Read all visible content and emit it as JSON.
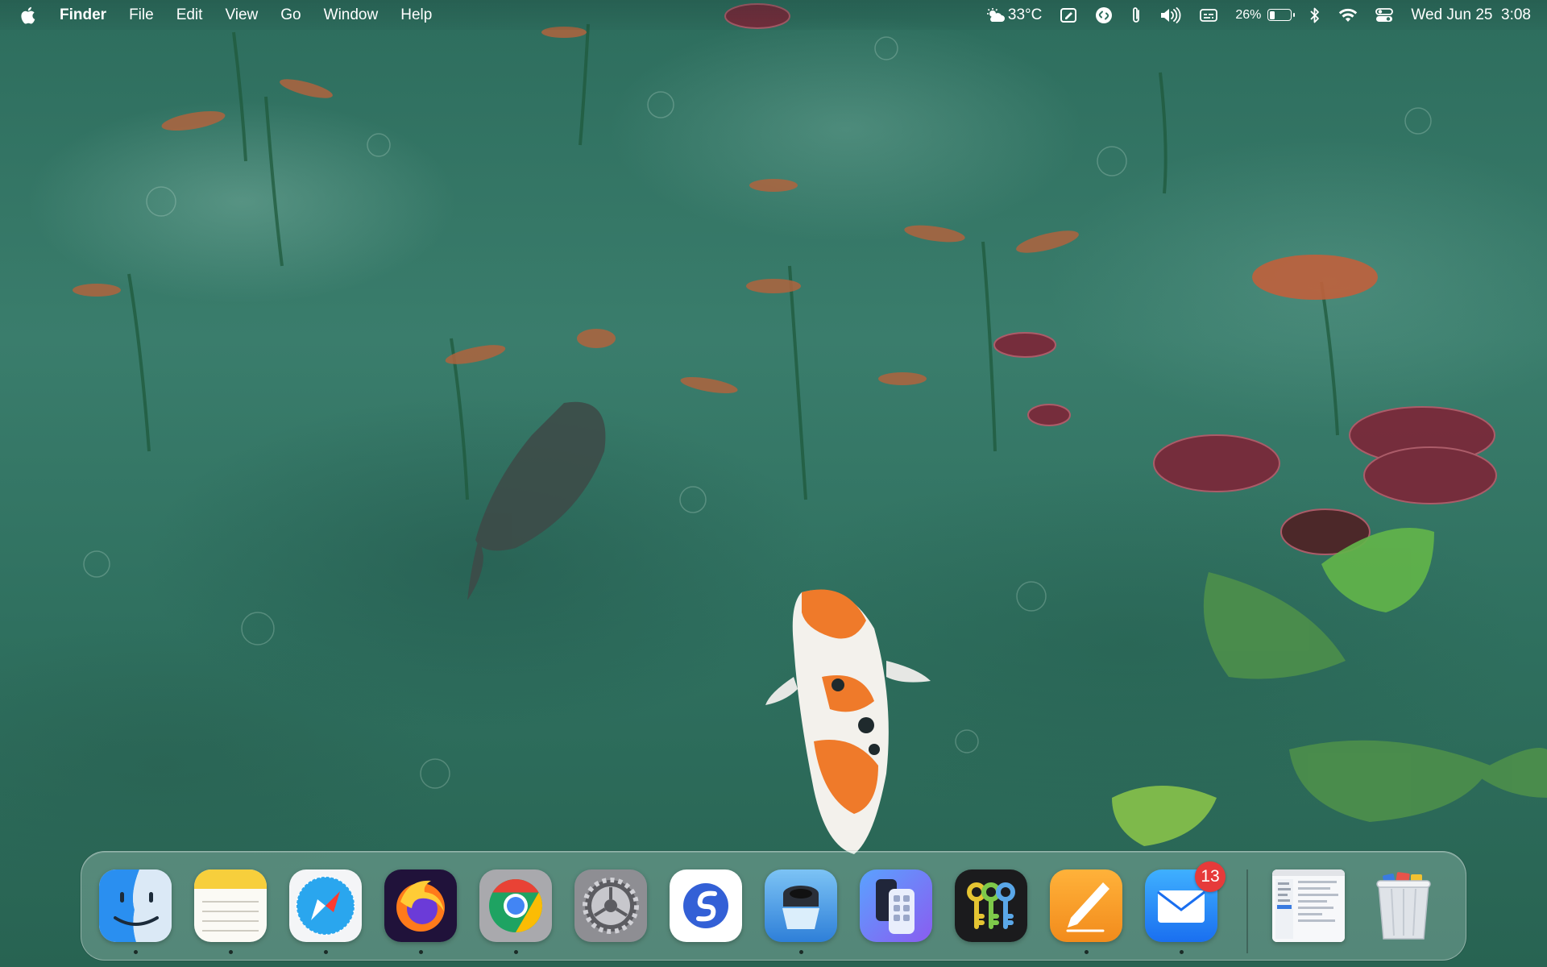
{
  "menubar": {
    "apple_icon": "apple-logo-icon",
    "app_name": "Finder",
    "menus": [
      "File",
      "Edit",
      "View",
      "Go",
      "Window",
      "Help"
    ],
    "status": {
      "weather_icon": "partly-cloudy-icon",
      "weather": "33°C",
      "battery_percent_text": "26%",
      "battery_level": 0.26,
      "clock": "Wed Jun 25  3:08"
    },
    "status_icons": [
      "weather-icon",
      "stylus-icon",
      "shazam-icon",
      "paperclip-icon",
      "volume-icon",
      "caption-icon",
      "battery-icon",
      "bluetooth-icon",
      "wifi-icon",
      "control-center-icon"
    ]
  },
  "dock": {
    "apps": [
      {
        "name": "Finder",
        "icon": "finder-icon",
        "running": true
      },
      {
        "name": "Notes",
        "icon": "notes-icon",
        "running": true
      },
      {
        "name": "Safari",
        "icon": "safari-icon",
        "running": true
      },
      {
        "name": "Firefox",
        "icon": "firefox-icon",
        "running": true
      },
      {
        "name": "Google Chrome",
        "icon": "chrome-icon",
        "running": true
      },
      {
        "name": "System Settings",
        "icon": "settings-gear-icon",
        "running": false
      },
      {
        "name": "Simplenote",
        "icon": "simplenote-icon",
        "running": false
      },
      {
        "name": "Lens",
        "icon": "lens-icon",
        "running": true
      },
      {
        "name": "iPhone Mirroring",
        "icon": "iphone-mirroring-icon",
        "running": false
      },
      {
        "name": "Keychain",
        "icon": "keys-icon",
        "running": false
      },
      {
        "name": "Pages",
        "icon": "pages-pen-icon",
        "running": true
      },
      {
        "name": "Mail",
        "icon": "mail-icon",
        "running": true,
        "badge": "13"
      }
    ],
    "recent": {
      "name": "Document preview",
      "icon": "document-thumbnail-icon"
    },
    "trash": {
      "name": "Trash",
      "icon": "trash-full-icon"
    }
  },
  "colors": {
    "badge": "#e63a3a",
    "wallpaper_water": "#2f6f5f"
  }
}
